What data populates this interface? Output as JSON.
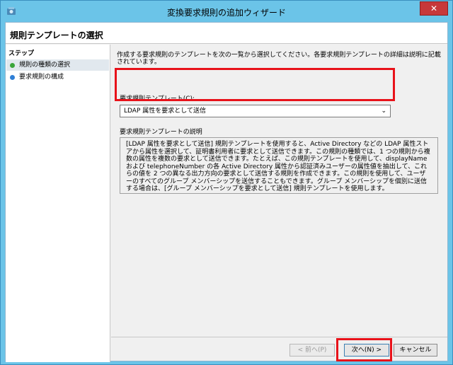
{
  "window": {
    "title": "変換要求規則の追加ウィザード",
    "close_label": "✕"
  },
  "header": {
    "title": "規則テンプレートの選択"
  },
  "steps": {
    "heading": "ステップ",
    "items": [
      {
        "label": "規則の種類の選択",
        "status": "current"
      },
      {
        "label": "要求規則の構成",
        "status": "pending"
      }
    ]
  },
  "main": {
    "intro": "作成する要求規則のテンプレートを次の一覧から選択してください。各要求規則テンプレートの詳細は説明に記載されています。",
    "template_label": "要求規則テンプレート(C):",
    "template_selected": "LDAP 属性を要求として送信",
    "description_label": "要求規則テンプレートの説明",
    "description": "[LDAP 属性を要求として送信] 規則テンプレートを使用すると、Active Directory などの LDAP 属性ストアから属性を選択して、証明書利用者に要求として送信できます。この規則の種類では、1 つの規則から複数の属性を複数の要求として送信できます。たとえば、この規則テンプレートを使用して、displayName および telephoneNumber の各 Active Directory 属性から認証済みユーザーの属性値を抽出して、これらの値を 2 つの異なる出力方向の要求として送信する規則を作成できます。この規則を使用して、ユーザーのすべてのグループ メンバーシップを送信することもできます。グループ メンバーシップを個別に送信する場合は、[グループ メンバーシップを要求として送信] 規則テンプレートを使用します。"
  },
  "footer": {
    "back_label": "< 前へ(P)",
    "next_label": "次へ(N) >",
    "cancel_label": "キャンセル"
  },
  "colors": {
    "title_bar": "#6bc4e8",
    "highlight_red": "#e8121a",
    "close_button": "#c7383a",
    "step_current": "#3aa53a",
    "step_pending": "#2f7fd6"
  }
}
